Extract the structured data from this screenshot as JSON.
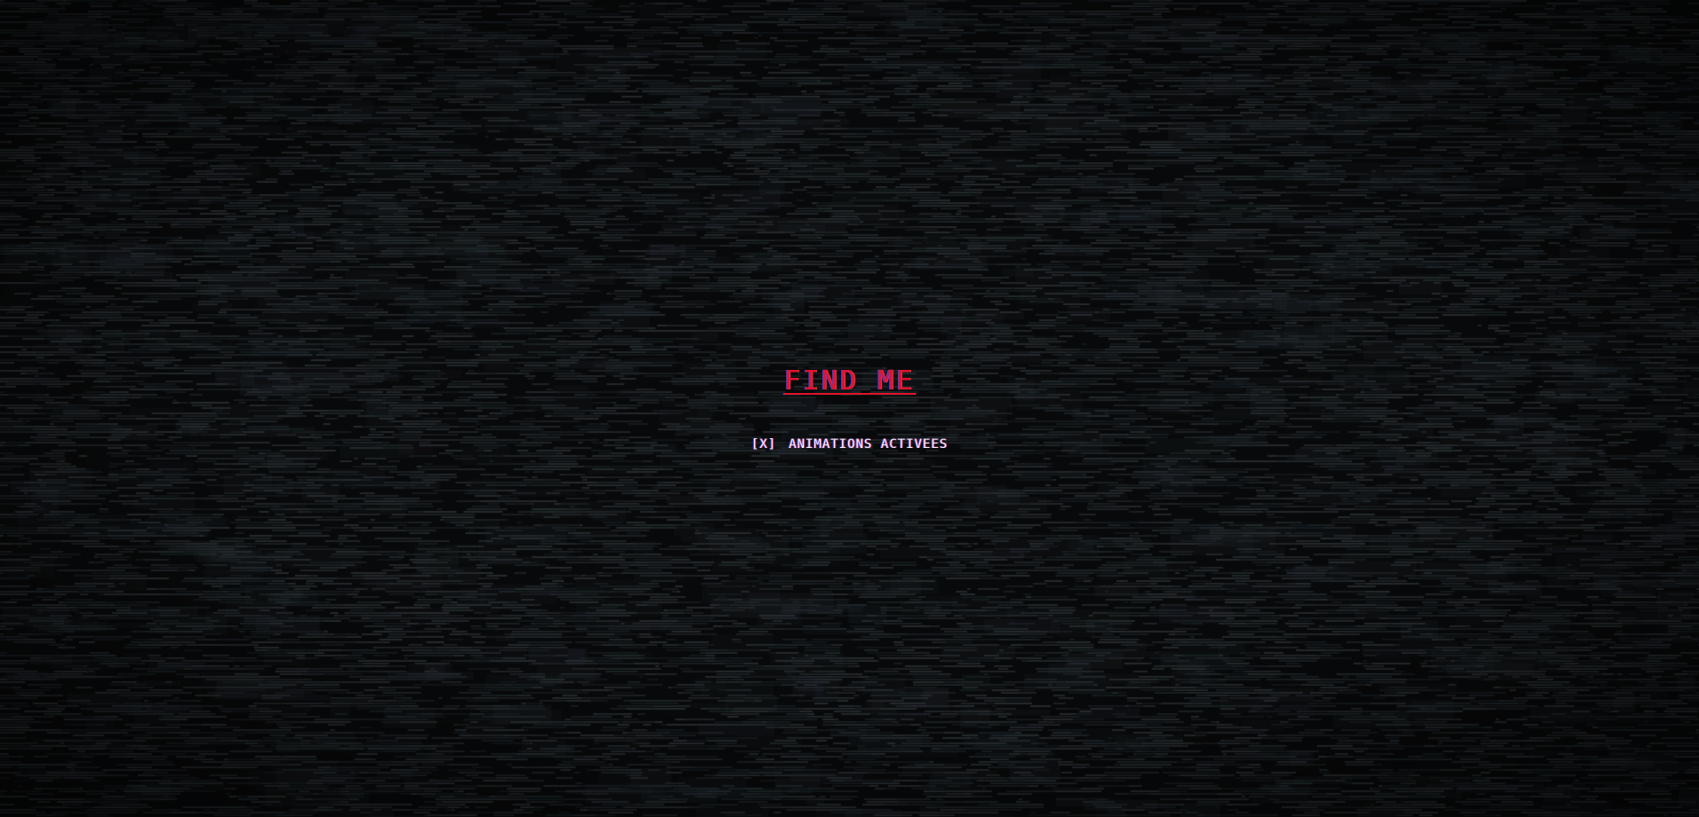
{
  "colors": {
    "background": "#08090a",
    "noise": "#1e2428",
    "title": "#e0142c",
    "text": "#f2f2f2"
  },
  "menu": {
    "title_link": "FIND ME",
    "animation_toggle": {
      "checkbox": "[X]",
      "label": "ANIMATIONS ACTIVEES"
    }
  }
}
